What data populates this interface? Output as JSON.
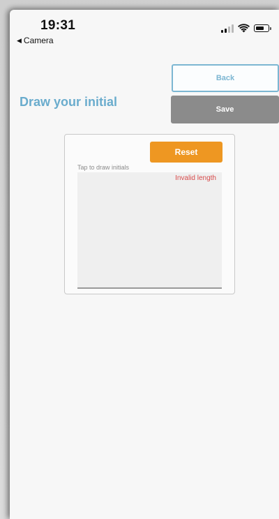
{
  "status_bar": {
    "time": "19:31",
    "back_app": "Camera",
    "back_glyph": "◀",
    "icons": [
      "signal-icon",
      "wifi-icon",
      "battery-icon"
    ]
  },
  "header": {
    "title": "Draw your initial",
    "back_label": "Back",
    "save_label": "Save"
  },
  "signature": {
    "reset_label": "Reset",
    "hint": "Tap to draw initials",
    "error": "Invalid length"
  },
  "colors": {
    "accent": "#6aaccd",
    "reset": "#ee9722",
    "save_disabled": "#8b8b8b",
    "error": "#d84b4b"
  }
}
